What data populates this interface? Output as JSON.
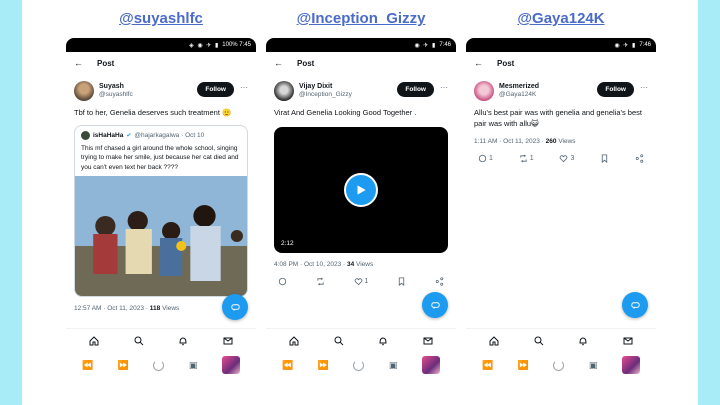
{
  "colors": {
    "accent": "#1d9bf0",
    "handle": "#4b6bc8",
    "band": "#a8ecf7"
  },
  "columns": [
    {
      "handle": "@suyashlfc",
      "status_time": "100% 7:45",
      "topbar_title": "Post",
      "display_name": "Suyash",
      "username": "@suyashlfc",
      "follow_label": "Follow",
      "text": "Tbf to her, Genelia deserves such treatment 🫡",
      "quote": {
        "name": "isHaHaHa",
        "meta": "@hajarkagalwa · Oct 10",
        "text": "This mf chased a girl around the whole school, singing trying to make her smile, just because her cat died and you can't even text her back ????"
      },
      "meta": "12:57 AM · Oct 11, 2023 · ",
      "views_count": "118",
      "views_label": " Views"
    },
    {
      "handle": "@Inception_Gizzy",
      "status_time": "7:46",
      "topbar_title": "Post",
      "display_name": "Vijay Dixit",
      "username": "@Inception_Gizzy",
      "follow_label": "Follow",
      "text": "Virat And Genelia Looking Good Together .",
      "video_time": "2:12",
      "meta": "4:08 PM · Oct 10, 2023 · ",
      "views_count": "34",
      "views_label": " Views",
      "likes": "1"
    },
    {
      "handle": "@Gaya124K",
      "status_time": "7:46",
      "topbar_title": "Post",
      "display_name": "Mesmerized",
      "username": "@Gaya124K",
      "follow_label": "Follow",
      "text": "Allu's best pair was with genelia and genelia's best pair was with allu😺",
      "meta": "1:11 AM · Oct 11, 2023 · ",
      "views_count": "260",
      "views_label": " Views",
      "replies": "1",
      "reposts": "1",
      "likes": "3"
    }
  ]
}
